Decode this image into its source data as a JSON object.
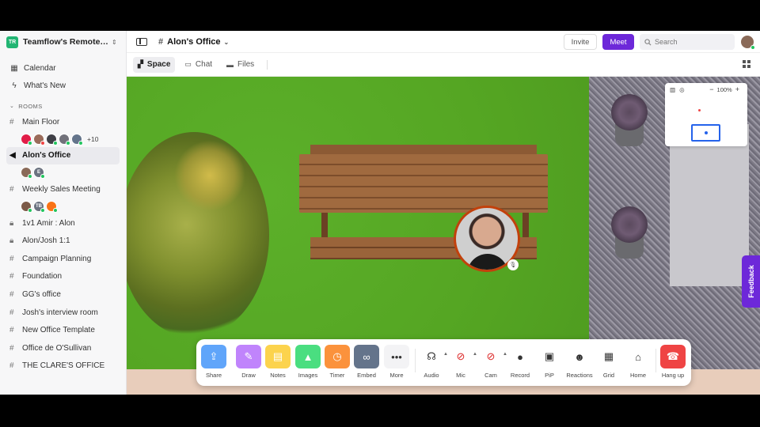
{
  "workspace": {
    "logo": "TR",
    "name": "Teamflow's Remote Of...",
    "chevron": "⌃⌄"
  },
  "sidebar": {
    "nav": [
      {
        "label": "Calendar",
        "icon": "calendar-icon"
      },
      {
        "label": "What's New",
        "icon": "lightning-icon"
      }
    ],
    "section_label": "ROOMS",
    "rooms": [
      {
        "label": "Main Floor",
        "icon": "hash-icon"
      },
      {
        "label": "Alon's Office",
        "icon": "speaker-icon"
      },
      {
        "label": "Weekly Sales Meeting",
        "icon": "hash-icon"
      },
      {
        "label": "1v1 Amir : Alon",
        "icon": "lock-icon"
      },
      {
        "label": "Alon/Josh 1:1",
        "icon": "lock-icon"
      },
      {
        "label": "Campaign Planning",
        "icon": "hash-icon"
      },
      {
        "label": "Foundation",
        "icon": "hash-icon"
      },
      {
        "label": "GG's office",
        "icon": "hash-icon"
      },
      {
        "label": "Josh's interview room",
        "icon": "hash-icon"
      },
      {
        "label": "New Office Template",
        "icon": "hash-icon"
      },
      {
        "label": "Office de O'Sullivan",
        "icon": "hash-icon"
      },
      {
        "label": "THE CLARE'S OFFICE",
        "icon": "hash-icon"
      }
    ],
    "main_floor_more": "+10",
    "alon_office_avatar_initial": "E",
    "sales_avatar_initial": "TB"
  },
  "topbar": {
    "room_title": "Alon's Office",
    "invite_label": "Invite",
    "meet_label": "Meet",
    "search_placeholder": "Search"
  },
  "tabs": [
    {
      "label": "Space",
      "icon": "space-icon"
    },
    {
      "label": "Chat",
      "icon": "chat-icon"
    },
    {
      "label": "Files",
      "icon": "folder-icon"
    }
  ],
  "minimap": {
    "zoom": "100%",
    "minus": "−",
    "plus": "+"
  },
  "feedback_label": "Feedback",
  "dock": [
    {
      "label": "Share",
      "icon": "share-icon",
      "color": "#60a5fa"
    },
    {
      "label": "Draw",
      "icon": "draw-icon",
      "color": "#c084fc"
    },
    {
      "label": "Notes",
      "icon": "notes-icon",
      "color": "#fcd34d"
    },
    {
      "label": "Images",
      "icon": "images-icon",
      "color": "#4ade80"
    },
    {
      "label": "Timer",
      "icon": "timer-icon",
      "color": "#fb923c"
    },
    {
      "label": "Embed",
      "icon": "embed-icon",
      "color": "#64748b"
    },
    {
      "label": "More",
      "icon": "more-icon"
    },
    {
      "label": "Audio",
      "icon": "headphones-icon"
    },
    {
      "label": "Mic",
      "icon": "mic-off-icon"
    },
    {
      "label": "Cam",
      "icon": "cam-off-icon"
    },
    {
      "label": "Record",
      "icon": "record-icon"
    },
    {
      "label": "PiP",
      "icon": "pip-icon"
    },
    {
      "label": "Reactions",
      "icon": "reactions-icon"
    },
    {
      "label": "Grid",
      "icon": "grid-icon"
    },
    {
      "label": "Home",
      "icon": "home-icon"
    },
    {
      "label": "Hang up",
      "icon": "hangup-icon",
      "color": "#ef4444"
    }
  ],
  "colors": {
    "accent": "#6d28d9",
    "online": "#22c55e",
    "workspace_logo": "#22b573"
  }
}
